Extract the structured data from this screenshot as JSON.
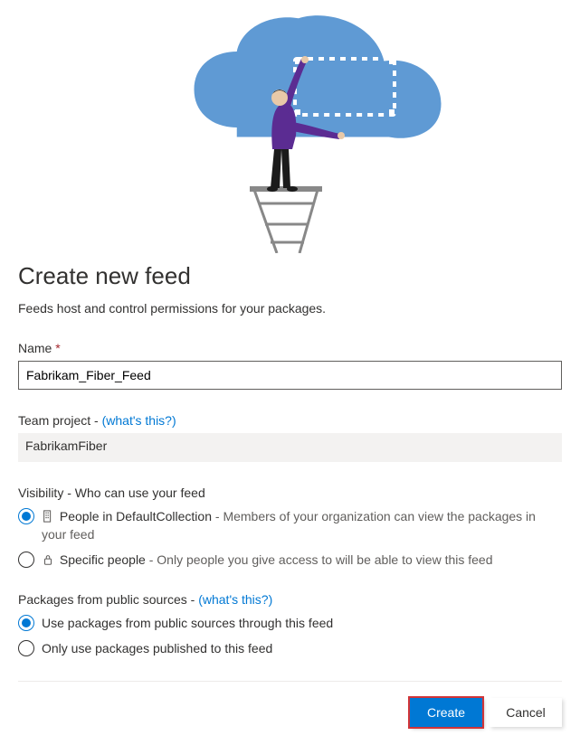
{
  "heading": "Create new feed",
  "subtitle": "Feeds host and control permissions for your packages.",
  "name": {
    "label": "Name",
    "required_marker": "*",
    "value": "Fabrikam_Fiber_Feed"
  },
  "team_project": {
    "label_prefix": "Team project - ",
    "link_text": "(what's this?)",
    "value": "FabrikamFiber"
  },
  "visibility": {
    "label": "Visibility - Who can use your feed",
    "options": [
      {
        "title": "People in DefaultCollection",
        "desc": " - Members of your organization can view the packages in your feed",
        "checked": true
      },
      {
        "title": "Specific people",
        "desc": " - Only people you give access to will be able to view this feed",
        "checked": false
      }
    ]
  },
  "public_sources": {
    "label_prefix": "Packages from public sources - ",
    "link_text": "(what's this?)",
    "options": [
      {
        "label": "Use packages from public sources through this feed",
        "checked": true
      },
      {
        "label": "Only use packages published to this feed",
        "checked": false
      }
    ]
  },
  "buttons": {
    "create": "Create",
    "cancel": "Cancel"
  }
}
